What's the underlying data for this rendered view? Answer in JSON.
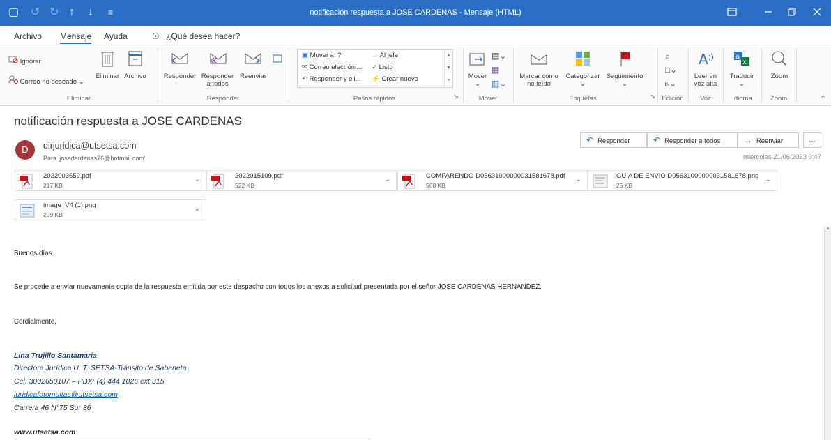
{
  "window": {
    "title": "notificación respuesta a JOSE CARDENAS  -  Mensaje (HTML)",
    "quick_access": [
      "▢",
      "↺",
      "↻",
      "↑",
      "↓",
      "≡"
    ]
  },
  "tabs": [
    "Archivo",
    "Mensaje",
    "Ayuda"
  ],
  "tell_me": "¿Qué desea hacer?",
  "ribbon": {
    "eliminar": {
      "ignorar": "Ignorar",
      "correo_no_deseado": "Correo no deseado",
      "eliminar": "Eliminar",
      "archivo": "Archivo",
      "label": "Eliminar"
    },
    "responder": {
      "responder": "Responder",
      "responder_todos_1": "Responder",
      "responder_todos_2": "a todos",
      "reenviar": "Reenviar",
      "label": "Responder"
    },
    "pasos_rapidos": {
      "mover_a": "Mover a: ?",
      "correo_electronico": "Correo electróni...",
      "responder_eli": "Responder y eli...",
      "al_jefe": "Al jefe",
      "listo": "Listo",
      "crear_nuevo": "Crear nuevo",
      "label": "Pasos rápidos"
    },
    "mover": {
      "mover": "Mover",
      "label": "Mover"
    },
    "etiquetas": {
      "marcar_1": "Marcar como",
      "marcar_2": "no leído",
      "categorizar": "Categorizar",
      "seguimiento": "Seguimiento",
      "label": "Etiquetas"
    },
    "edicion": {
      "label": "Edición"
    },
    "voz": {
      "leer_1": "Leer en",
      "leer_2": "voz alta",
      "label": "Voz"
    },
    "idioma": {
      "traducir": "Traducir",
      "label": "Idioma"
    },
    "zoom": {
      "zoom": "Zoom",
      "label": "Zoom"
    }
  },
  "message": {
    "subject": "notificación respuesta a JOSE CARDENAS",
    "avatar_letter": "D",
    "sender": "dirjuridica@utsetsa.com",
    "to": "Para  'josedardenas76@hotmail.com'",
    "datetime": "miércoles 21/06/2023 9:47",
    "actions": {
      "responder": "Responder",
      "responder_todos": "Responder a todos",
      "reenviar": "Reenviar",
      "more": "…"
    }
  },
  "attachments": [
    {
      "name": "2022003659.pdf",
      "size": "217 KB",
      "type": "pdf"
    },
    {
      "name": "2022015109.pdf",
      "size": "522 KB",
      "type": "pdf"
    },
    {
      "name": "COMPARENDO D05631000000031581678.pdf",
      "size": "568 KB",
      "type": "pdf"
    },
    {
      "name": "GUIA DE ENVIO D05631000000031581678.png",
      "size": "25 KB",
      "type": "png"
    },
    {
      "name": "image_V4 (1).png",
      "size": "209 KB",
      "type": "png"
    }
  ],
  "body": {
    "greeting": "Buenos días",
    "paragraph": "Se procede a enviar nuevamente copia de la respuesta emitida por este despacho con todos los anexos a solicitud presentada por el señor JOSE CARDENAS HERNANDEZ.",
    "closing": "Cordialmente,",
    "signature": {
      "name": "Lina Trujillo Santamaria",
      "role": "Directora Jurídica  U. T. SETSA-Tránsito de Sabaneta",
      "phone": "Cel: 3002650107 – PBX: (4) 444 1026 ext 315",
      "email": "juridicafotomultas@utsetsa.com",
      "address": "Carrera 46 N°75 Sur 36",
      "website": "www.utsetsa.com"
    }
  },
  "colors": {
    "titlebar": "#2b6fc4",
    "avatar": "#a4373a",
    "pdf_red": "#c4161c",
    "signature_blue": "#1f3864",
    "link_blue": "#0563c1"
  }
}
